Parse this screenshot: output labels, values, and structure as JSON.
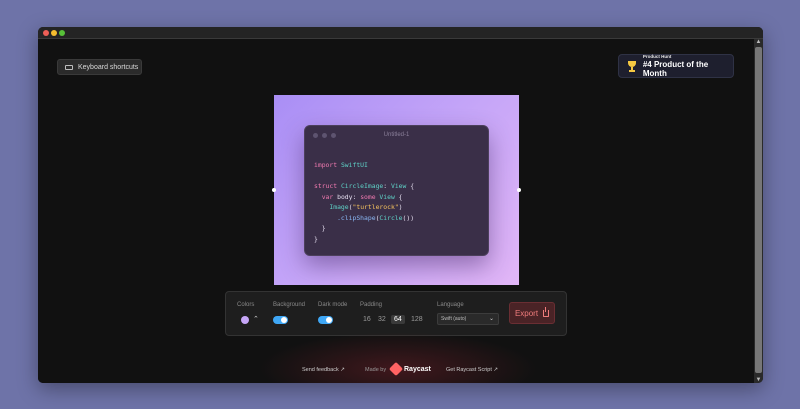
{
  "topbar": {
    "keyboard_shortcuts": "Keyboard shortcuts"
  },
  "badge": {
    "label_small": "Product Hunt",
    "label_big": "#4 Product of the Month"
  },
  "editor": {
    "window_title": "Untitled-1",
    "code_lines": [
      [
        {
          "t": "import",
          "c": "kw"
        },
        {
          "t": " SwiftUI",
          "c": "ty"
        }
      ],
      [
        {
          "t": "",
          "c": ""
        }
      ],
      [
        {
          "t": "struct",
          "c": "kw"
        },
        {
          "t": " CircleImage",
          "c": "ty"
        },
        {
          "t": ": ",
          "c": ""
        },
        {
          "t": "View",
          "c": "ty"
        },
        {
          "t": " {",
          "c": ""
        }
      ],
      [
        {
          "t": "  var",
          "c": "kw"
        },
        {
          "t": " body: ",
          "c": ""
        },
        {
          "t": "some",
          "c": "kw"
        },
        {
          "t": " View",
          "c": "ty"
        },
        {
          "t": " {",
          "c": ""
        }
      ],
      [
        {
          "t": "    Image",
          "c": "ty"
        },
        {
          "t": "(",
          "c": ""
        },
        {
          "t": "\"turtlerock\"",
          "c": "st"
        },
        {
          "t": ")",
          "c": ""
        }
      ],
      [
        {
          "t": "      .clipShape",
          "c": "fn"
        },
        {
          "t": "(",
          "c": ""
        },
        {
          "t": "Circle",
          "c": "ty"
        },
        {
          "t": "())",
          "c": ""
        }
      ],
      [
        {
          "t": "  }",
          "c": ""
        }
      ],
      [
        {
          "t": "}",
          "c": ""
        }
      ]
    ]
  },
  "toolbar": {
    "colors_label": "Colors",
    "background_label": "Background",
    "darkmode_label": "Dark mode",
    "padding_label": "Padding",
    "padding_options": [
      "16",
      "32",
      "64",
      "128"
    ],
    "padding_selected": "64",
    "language_label": "Language",
    "language_value": "Swift (auto)",
    "export_label": "Export",
    "background_on": true,
    "darkmode_on": true,
    "swatch_color": "#c6a6f8"
  },
  "footer": {
    "feedback": "Send feedback ↗",
    "made_by": "Made by",
    "brand": "Raycast",
    "script": "Get Raycast Script ↗"
  }
}
